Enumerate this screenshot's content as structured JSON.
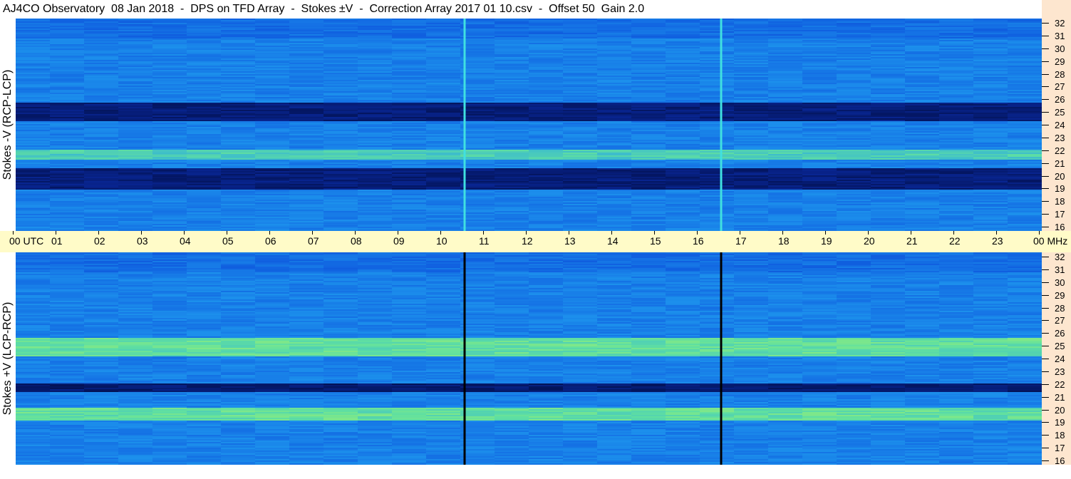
{
  "title": "AJ4CO Observatory  08 Jan 2018  -  DPS on TFD Array  -  Stokes ±V  -  Correction Array 2017 01 10.csv  -  Offset 50  Gain 2.0",
  "chart_data": [
    {
      "type": "heatmap",
      "panel": "top",
      "ylabel": "Stokes -V (RCP-LCP)",
      "x_ticks": [
        "00 UTC",
        "01",
        "02",
        "03",
        "04",
        "05",
        "06",
        "07",
        "08",
        "09",
        "10",
        "11",
        "12",
        "13",
        "14",
        "15",
        "16",
        "17",
        "18",
        "19",
        "20",
        "21",
        "22",
        "23",
        "00 MHz"
      ],
      "xlim_hours": [
        0,
        24
      ],
      "y_ticks": [
        "32",
        "31",
        "30",
        "29",
        "28",
        "27",
        "26",
        "25",
        "24",
        "23",
        "22",
        "21",
        "20",
        "19",
        "18",
        "17",
        "16"
      ],
      "ylim_mhz": [
        16,
        32
      ],
      "colormap": [
        "#000a3c",
        "#0a2aa0",
        "#1060e0",
        "#20a0f0",
        "#60e0a0",
        "#e0ff40"
      ],
      "features": {
        "dark_bands_mhz": [
          [
            24.3,
            25.7
          ],
          [
            19.2,
            20.8
          ]
        ],
        "bright_band_mhz": [
          21.4,
          22.2
        ],
        "vertical_lines_utc_hours": [
          10.5,
          16.5
        ],
        "vertical_line_color": "#40e0e0"
      }
    },
    {
      "type": "heatmap",
      "panel": "bottom",
      "ylabel": "Stokes +V (LCP-RCP)",
      "y_ticks": [
        "32",
        "31",
        "30",
        "29",
        "28",
        "27",
        "26",
        "25",
        "24",
        "23",
        "22",
        "21",
        "20",
        "19",
        "18",
        "17",
        "16"
      ],
      "ylim_mhz": [
        16,
        32
      ],
      "colormap": [
        "#000a3c",
        "#0a2aa0",
        "#1060e0",
        "#20a0f0",
        "#60e0a0",
        "#e0ff40"
      ],
      "features": {
        "bright_bands_mhz": [
          [
            24.2,
            25.6
          ],
          [
            19.4,
            20.4
          ]
        ],
        "dark_band_mhz": [
          21.5,
          22.2
        ],
        "vertical_lines_utc_hours": [
          10.5,
          16.5
        ],
        "vertical_line_color": "#000000"
      }
    }
  ],
  "colors": {
    "time_axis_bg": "#fffbc8",
    "freq_axis_bg": "#fde6cf"
  }
}
